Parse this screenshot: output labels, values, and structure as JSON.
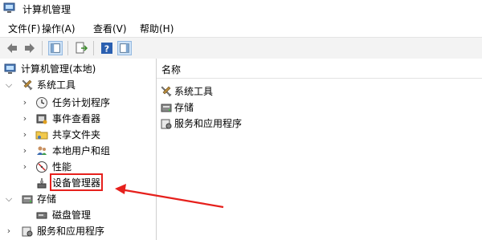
{
  "window": {
    "title": "计算机管理"
  },
  "menubar": [
    "文件(F)",
    "操作(A)",
    "查看(V)",
    "帮助(H)"
  ],
  "toolbar": {
    "buttons": [
      "back-arrow-icon",
      "forward-arrow-icon",
      "show-tree-icon",
      "export-list-icon",
      "help-icon",
      "show-action-pane-icon"
    ]
  },
  "tree": {
    "root": "计算机管理(本地)",
    "system_tools": "系统工具",
    "task_scheduler": "任务计划程序",
    "event_viewer": "事件查看器",
    "shared_folders": "共享文件夹",
    "local_users": "本地用户和组",
    "performance": "性能",
    "device_manager": "设备管理器",
    "storage": "存储",
    "disk_management": "磁盘管理",
    "services": "服务和应用程序"
  },
  "right_pane": {
    "column_name": "名称",
    "items": [
      "系统工具",
      "存储",
      "服务和应用程序"
    ]
  },
  "annotation": {
    "highlight_color": "#e6201c"
  }
}
